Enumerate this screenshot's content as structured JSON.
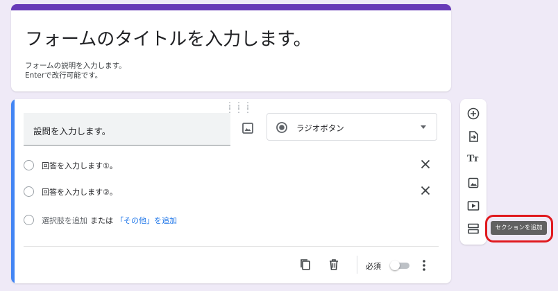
{
  "form": {
    "title": "フォームのタイトルを入力します。",
    "description_line1": "フォームの説明を入力します。",
    "description_line2": "Enterで改行可能です。"
  },
  "question": {
    "title": "設問を入力します。",
    "type_label": "ラジオボタン",
    "options": [
      "回答を入力します①。",
      "回答を入力します②。"
    ],
    "add_option_label": "選択肢を追加",
    "or_label": "または",
    "add_other_label": "「その他」を追加",
    "required_label": "必須",
    "required": false
  },
  "toolbar": {
    "buttons": [
      "add-question-icon",
      "import-questions-icon",
      "add-title-icon",
      "add-image-icon",
      "add-video-icon",
      "add-section-icon"
    ],
    "tooltip": "セクションを追加"
  },
  "colors": {
    "accent": "#673ab7",
    "active_bar": "#4285f4",
    "highlight": "#e0191e",
    "link": "#1a73e8",
    "background": "#efeaf7"
  }
}
